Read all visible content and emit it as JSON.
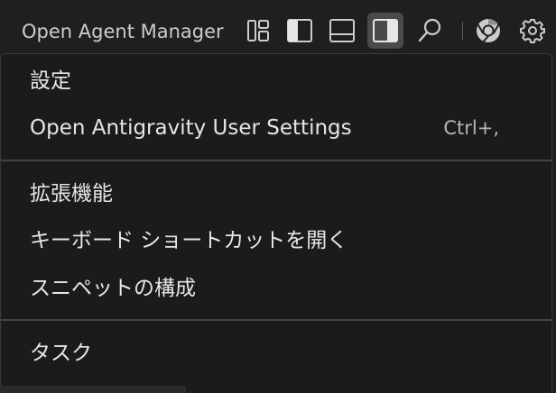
{
  "titlebar": {
    "agent_manager_label": "Open Agent Manager",
    "icons": [
      "customize-layout-icon",
      "toggle-primary-sidebar-icon",
      "toggle-panel-icon",
      "toggle-secondary-sidebar-icon",
      "search-icon",
      "chrome-icon",
      "gear-icon"
    ]
  },
  "menu": {
    "section_title": "設定",
    "user_settings_label": "Open Antigravity User Settings",
    "user_settings_shortcut": "Ctrl+,",
    "extensions_label": "拡張機能",
    "keyboard_shortcuts_label": "キーボード ショートカットを開く",
    "snippets_label": "スニペットの構成",
    "tasks_label": "タスク"
  },
  "colors": {
    "background": "#1f1f1f",
    "menu_background": "#1b1b1b",
    "text": "#e6e6e6",
    "separator": "#444444",
    "active_toggle": "#4a4a4a"
  }
}
